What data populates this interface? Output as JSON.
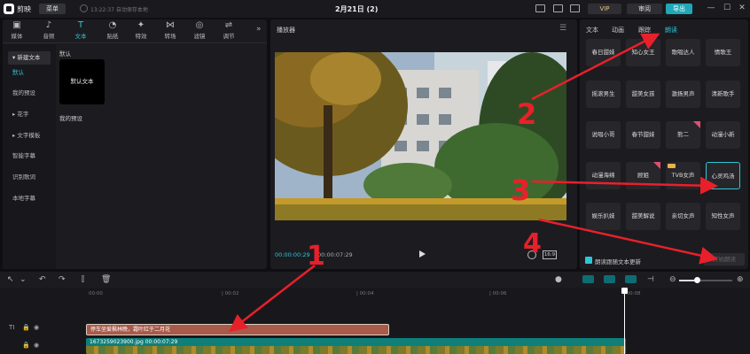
{
  "titlebar": {
    "app_name": "剪映",
    "menu_label": "菜单",
    "save_status": "13:22:37 自动保存本地",
    "doc_title": "2月21日 (2)",
    "vip_label": "VIP",
    "review_label": "审阅",
    "export_label": "导出",
    "minimize": "—",
    "maximize": "☐",
    "close": "✕"
  },
  "left_panel": {
    "tabs": [
      {
        "label": "媒体",
        "icon": "media-icon"
      },
      {
        "label": "音频",
        "icon": "audio-icon"
      },
      {
        "label": "文本",
        "icon": "text-icon"
      },
      {
        "label": "贴纸",
        "icon": "sticker-icon"
      },
      {
        "label": "特效",
        "icon": "effects-icon"
      },
      {
        "label": "转场",
        "icon": "transition-icon"
      },
      {
        "label": "滤镜",
        "icon": "filter-icon"
      },
      {
        "label": "调节",
        "icon": "adjust-icon"
      }
    ],
    "active_tab": "文本",
    "nav": {
      "new_text": "▾ 新建文本",
      "default": "默认",
      "my_presets": "我的预设",
      "flower_text": "▸ 花字",
      "text_template": "▸ 文字模板",
      "smart_caption": "智能字幕",
      "recognize_lyrics": "识别歌词",
      "local_caption": "本地字幕"
    },
    "section_default": "默认",
    "default_card": "默认文本",
    "section_my_presets": "我的预设"
  },
  "player": {
    "title": "播放器",
    "timecode_current": "00:00:00:29",
    "timecode_total": "00:00:07:29",
    "aspect_label": "16:9"
  },
  "right_panel": {
    "tabs": [
      "文本",
      "动画",
      "跟踪",
      "朗读"
    ],
    "active_tab": "朗读",
    "voices": [
      [
        "春日甜妹",
        "知心女王",
        "歌唱达人",
        "情歌王"
      ],
      [
        "摇滚男生",
        "甜美女孩",
        "激扬男声",
        "清新歌手"
      ],
      [
        "说唱小哥",
        "春节甜妹",
        "熊二",
        "动漫小新"
      ],
      [
        "动漫海绵",
        "顾姐",
        "TVB女声",
        "心灵鸡汤"
      ],
      [
        "娱乐扒妹",
        "甜美解说",
        "亲切女声",
        "知性女声"
      ]
    ],
    "follow_label": "朗读跟随文本更新",
    "start_button": "开始朗读"
  },
  "timeline": {
    "ruler": [
      "00:00",
      "| 00:02",
      "| 00:04",
      "| 00:06",
      "| 00:08"
    ],
    "text_clip": "停车坐爱枫林晚，霜叶红于二月花",
    "video_clip": "1673259023900.jpg  00:00:07:29"
  },
  "annotations": [
    "1",
    "2",
    "3",
    "4"
  ],
  "colors": {
    "accent": "#2ec6d6",
    "arrow": "#e8202a",
    "text_clip": "#a95a4b",
    "video_clip": "#0f7f7a"
  }
}
